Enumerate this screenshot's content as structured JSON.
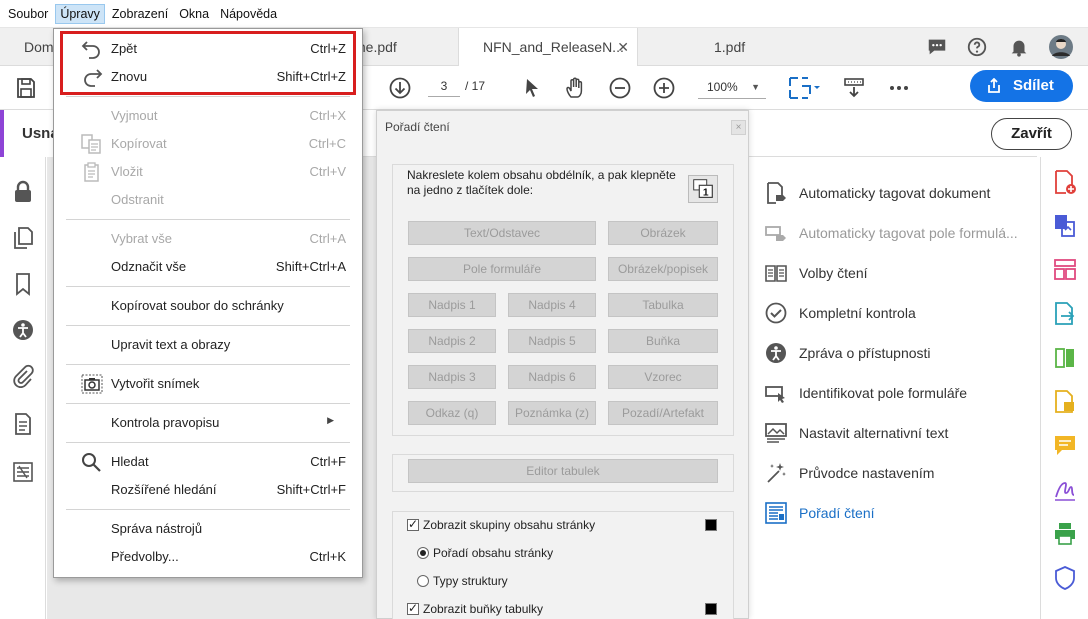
{
  "menubar": {
    "items": [
      "Soubor",
      "Úpravy",
      "Zobrazení",
      "Okna",
      "Nápověda"
    ],
    "active": "Úpravy"
  },
  "tabs": [
    {
      "label": "Dom"
    },
    {
      "label": "me.pdf"
    },
    {
      "label": "NFN_and_ReleaseN..."
    },
    {
      "label": "1.pdf"
    }
  ],
  "tab_close_glyph": "✕",
  "toolbar": {
    "page_current": "3",
    "page_total": "/ 17",
    "zoom": "100%",
    "share_label": "Sdílet"
  },
  "pane": {
    "tool_title": "Usna",
    "close_label": "Zavřít",
    "tools": [
      {
        "label": "Automaticky tagovat dokument",
        "icon": "doc-tag-icon",
        "state": "normal"
      },
      {
        "label": "Automaticky tagovat pole formulá...",
        "icon": "form-tag-icon",
        "state": "disabled"
      },
      {
        "label": "Volby čtení",
        "icon": "book-icon",
        "state": "normal"
      },
      {
        "label": "Kompletní kontrola",
        "icon": "check-circle-icon",
        "state": "normal"
      },
      {
        "label": "Zpráva o přístupnosti",
        "icon": "accessibility-icon",
        "state": "normal"
      },
      {
        "label": "Identifikovat pole formuláře",
        "icon": "form-field-icon",
        "state": "normal"
      },
      {
        "label": "Nastavit alternativní text",
        "icon": "image-text-icon",
        "state": "normal"
      },
      {
        "label": "Průvodce nastavením",
        "icon": "sparkle-icon",
        "state": "normal"
      },
      {
        "label": "Pořadí čtení",
        "icon": "reading-order-icon",
        "state": "selected"
      }
    ]
  },
  "reading_order": {
    "title": "Pořadí čtení",
    "close_glyph": "×",
    "instructions": "Nakreslete kolem obsahu obdélník, a pak klepněte na jedno z tlačítek dole:",
    "buttons": {
      "text": "Text/Odstavec",
      "figure": "Obrázek",
      "form_field": "Pole formuláře",
      "figure_caption": "Obrázek/popisek",
      "h1": "Nadpis 1",
      "h4": "Nadpis 4",
      "table": "Tabulka",
      "h2": "Nadpis 2",
      "h5": "Nadpis 5",
      "cell": "Buňka",
      "h3": "Nadpis 3",
      "h6": "Nadpis 6",
      "formula": "Vzorec",
      "reference": "Odkaz (q)",
      "note": "Poznámka (z)",
      "background": "Pozadí/Artefakt",
      "table_editor": "Editor tabulek"
    },
    "show_groups": "Zobrazit skupiny obsahu stránky",
    "page_content_order": "Pořadí obsahu stránky",
    "structure_types": "Typy struktury",
    "show_table_cells": "Zobrazit buňky tabulky"
  },
  "edit_menu": {
    "undo": {
      "label": "Zpět",
      "shortcut": "Ctrl+Z"
    },
    "redo": {
      "label": "Znovu",
      "shortcut": "Shift+Ctrl+Z"
    },
    "cut": {
      "label": "Vyjmout",
      "shortcut": "Ctrl+X"
    },
    "copy": {
      "label": "Kopírovat",
      "shortcut": "Ctrl+C"
    },
    "paste": {
      "label": "Vložit",
      "shortcut": "Ctrl+V"
    },
    "delete": {
      "label": "Odstranit",
      "shortcut": ""
    },
    "select_all": {
      "label": "Vybrat vše",
      "shortcut": "Ctrl+A"
    },
    "deselect_all": {
      "label": "Odznačit vše",
      "shortcut": "Shift+Ctrl+A"
    },
    "copy_file": {
      "label": "Kopírovat soubor do schránky"
    },
    "edit_text": {
      "label": "Upravit text a obrazy"
    },
    "snapshot": {
      "label": "Vytvořit snímek"
    },
    "spelling": {
      "label": "Kontrola pravopisu"
    },
    "find": {
      "label": "Hledat",
      "shortcut": "Ctrl+F"
    },
    "adv_search": {
      "label": "Rozšířené hledání",
      "shortcut": "Shift+Ctrl+F"
    },
    "manage_tools": {
      "label": "Správa nástrojů"
    },
    "preferences": {
      "label": "Předvolby...",
      "shortcut": "Ctrl+K"
    }
  },
  "colors": {
    "accent": "#1473e6",
    "highlight": "#d81e1e",
    "purple_marker": "#8e44d6"
  }
}
